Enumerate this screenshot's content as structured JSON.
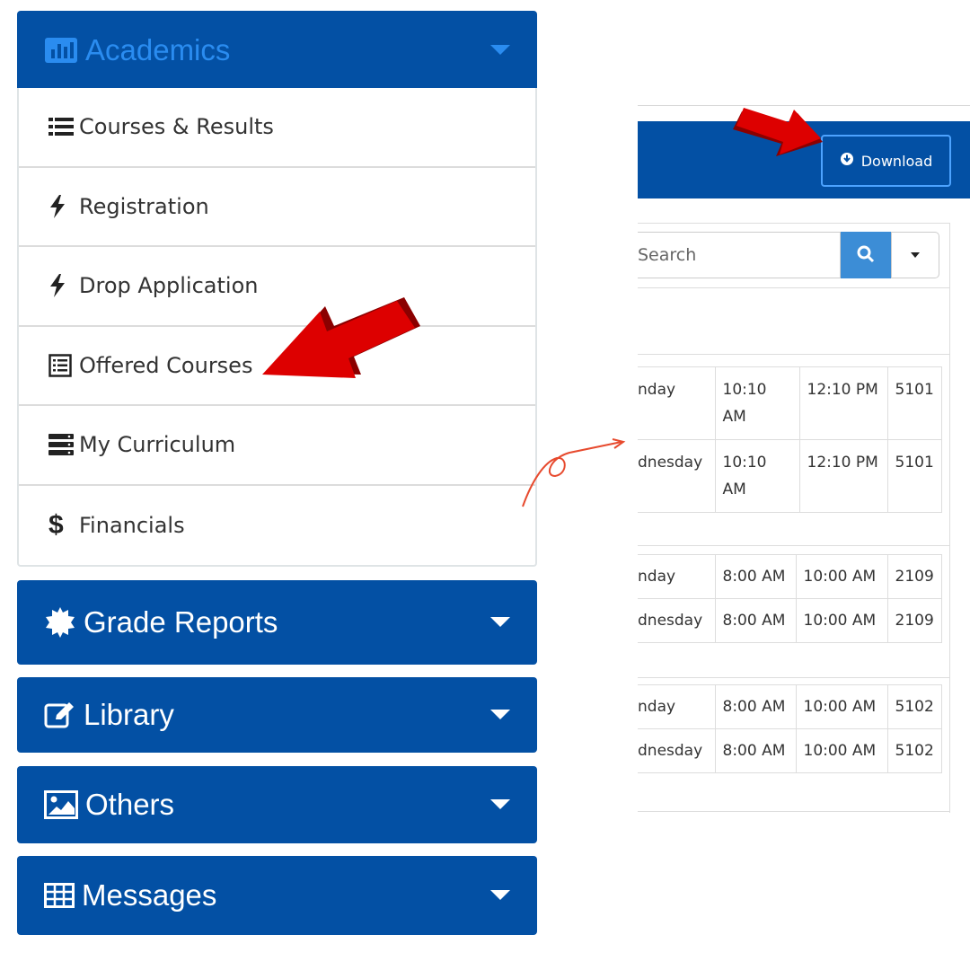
{
  "sidebar": {
    "academics": {
      "title": "Academics",
      "items": [
        {
          "label": "Courses & Results",
          "icon": "list-icon"
        },
        {
          "label": "Registration",
          "icon": "bolt-icon"
        },
        {
          "label": "Drop Application",
          "icon": "bolt-icon"
        },
        {
          "label": "Offered Courses",
          "icon": "document-list-icon"
        },
        {
          "label": "My Curriculum",
          "icon": "server-icon"
        },
        {
          "label": "Financials",
          "icon": "dollar-icon"
        }
      ]
    },
    "sections": [
      {
        "label": "Grade Reports",
        "icon": "certificate-icon"
      },
      {
        "label": "Library",
        "icon": "edit-icon"
      },
      {
        "label": "Others",
        "icon": "image-icon"
      },
      {
        "label": "Messages",
        "icon": "table-icon"
      }
    ]
  },
  "toolbar": {
    "download_label": "Download"
  },
  "search": {
    "placeholder": "Search"
  },
  "schedule": {
    "group1": [
      {
        "day": "nday",
        "start": "10:10 AM",
        "end": "12:10 PM",
        "room": "5101"
      },
      {
        "day": "dnesday",
        "start": "10:10 AM",
        "end": "12:10 PM",
        "room": "5101"
      }
    ],
    "group2": [
      {
        "day": "nday",
        "start": "8:00 AM",
        "end": "10:00 AM",
        "room": "2109"
      },
      {
        "day": "dnesday",
        "start": "8:00 AM",
        "end": "10:00 AM",
        "room": "2109"
      }
    ],
    "group3": [
      {
        "day": "nday",
        "start": "8:00 AM",
        "end": "10:00 AM",
        "room": "5102"
      },
      {
        "day": "dnesday",
        "start": "8:00 AM",
        "end": "10:00 AM",
        "room": "5102"
      }
    ]
  },
  "colors": {
    "primary": "#0350a4",
    "accent": "#2a8cf0",
    "arrow": "#dd0000"
  }
}
